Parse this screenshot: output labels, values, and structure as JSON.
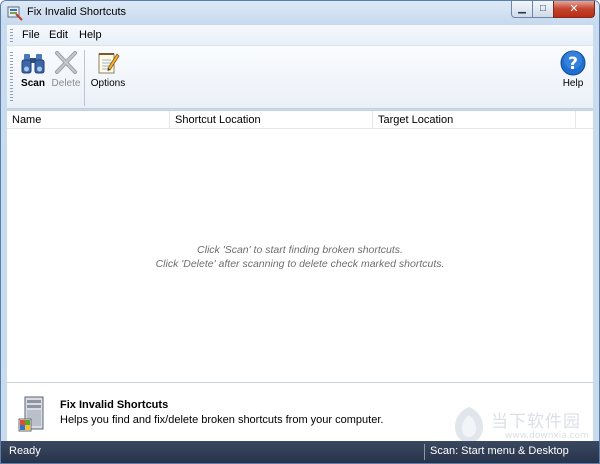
{
  "window": {
    "title": "Fix Invalid Shortcuts"
  },
  "menu": {
    "file": "File",
    "edit": "Edit",
    "help": "Help"
  },
  "toolbar": {
    "scan": "Scan",
    "delete": "Delete",
    "options": "Options",
    "help": "Help"
  },
  "columns": [
    "Name",
    "Shortcut Location",
    "Target Location"
  ],
  "list": {
    "empty_line1": "Click 'Scan' to start finding broken shortcuts.",
    "empty_line2": "Click 'Delete' after scanning to delete check marked shortcuts."
  },
  "info": {
    "title": "Fix Invalid Shortcuts",
    "description": "Helps you find and fix/delete broken shortcuts from your computer."
  },
  "status": {
    "left": "Ready",
    "right": "Scan: Start menu & Desktop"
  },
  "watermark": {
    "text": "当下软件园",
    "url": "www.downxia.com"
  },
  "colors": {
    "statusbar": "#2c3850",
    "help_blue": "#1f6fd0",
    "close_red": "#c4432c"
  }
}
